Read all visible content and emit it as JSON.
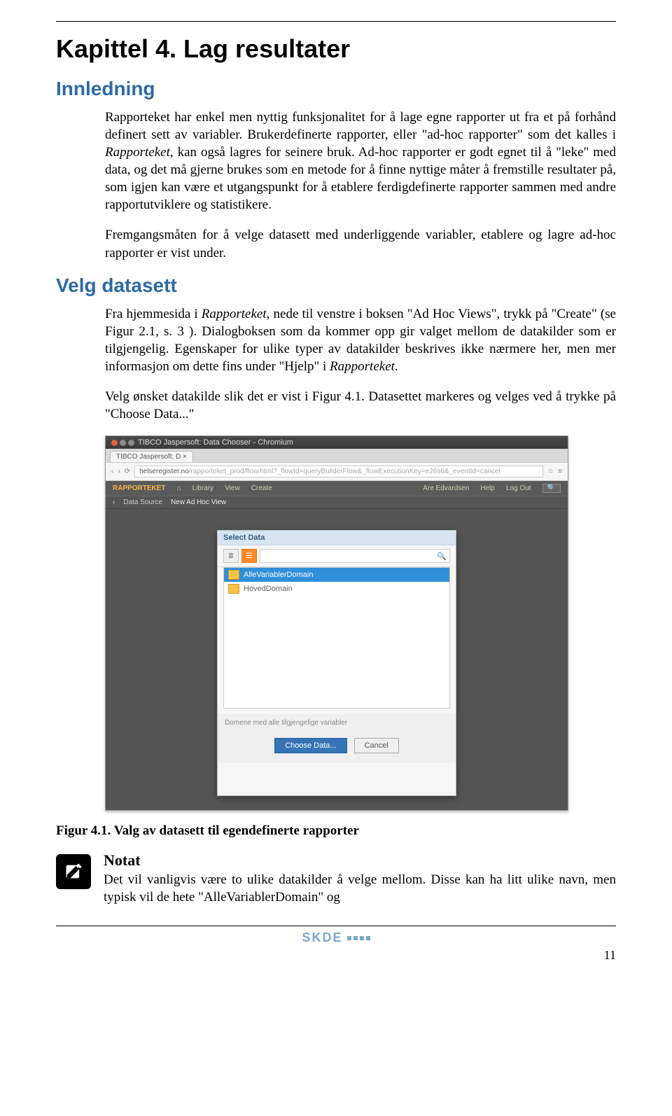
{
  "chapter_title": "Kapittel 4. Lag resultater",
  "section_innledning": "Innledning",
  "para1_a": "Rapporteket har enkel men nyttig funksjonalitet for å lage egne rapporter ut fra et på forhånd definert sett av variabler. Brukerdefinerte rapporter, eller \"ad-hoc rapporter\" som det kalles i ",
  "para1_b": "Rapporteket",
  "para1_c": ", kan også lagres for seinere bruk. Ad-hoc rapporter er godt egnet til å \"leke\" med data, og det må gjerne brukes som en metode for å finne nyttige måter å fremstille resultater på, som igjen kan være et utgangspunkt for å etablere ferdigdefinerte rapporter sammen med andre rapportutviklere og statistikere.",
  "para2": "Fremgangsmåten for å velge datasett med underliggende variabler, etablere og lagre ad-hoc rapporter er vist under.",
  "section_velg": "Velg datasett",
  "para3_a": "Fra hjemmesida i ",
  "para3_b": "Rapporteket",
  "para3_c": ", nede til venstre i boksen \"Ad Hoc Views\", trykk på \"Create\" (se Figur 2.1, s. 3 ). Dialogboksen som da kommer opp gir valget mellom de datakilder som er tilgjengelig. Egenskaper for ulike typer av datakilder beskrives ikke nærmere her, men mer informasjon om dette fins under \"Hjelp\" i ",
  "para3_d": "Rapporteket",
  "para3_e": ".",
  "para4": "Velg ønsket datakilde slik det er vist i Figur 4.1. Datasettet markeres og velges ved å trykke på \"Choose Data...\"",
  "screenshot": {
    "window_title": "TIBCO Jaspersoft: Data Chooser - Chromium",
    "browser_tab": "TIBCO Jaspersoft: D ×",
    "url_host": "helseregister.no",
    "url_path": "/rapporteket_prod/flow.html?_flowId=queryBuilderFlow&_flowExecutionKey=e26s6&_eventId=cancel",
    "brand": "RAPPORTEKET",
    "menu_library": "Library",
    "menu_view": "View",
    "menu_create": "Create",
    "user": "Are Edvardsen",
    "menu_help": "Help",
    "menu_logout": "Log Out",
    "bar_datasource": "Data Source",
    "bar_newview": "New Ad Hoc View",
    "dialog_title": "Select Data",
    "item_selected": "AlleVariablerDomain",
    "item_other": "HovedDomain",
    "footer_text": "Domene med alle tilgjengelige variabler",
    "btn_choose": "Choose Data...",
    "btn_cancel": "Cancel"
  },
  "figure_caption": "Figur 4.1. Valg av datasett til egendefinerte rapporter",
  "note_heading": "Notat",
  "note_body": "Det vil vanligvis være to ulike datakilder å velge mellom. Disse kan ha litt ulike navn, men typisk vil de hete \"AlleVariablerDomain\" og",
  "logo": "SKDE",
  "page_number": "11"
}
